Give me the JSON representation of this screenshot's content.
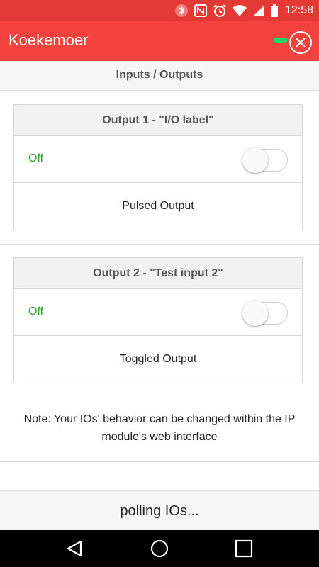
{
  "status_bar": {
    "icons": [
      "bluetooth-icon",
      "nfc-icon",
      "alarm-icon",
      "wifi-icon",
      "cellular-signal-icon",
      "battery-icon"
    ],
    "time": "12:58"
  },
  "app_bar": {
    "title": "Koekemoer",
    "connection_color": "#21d36b",
    "background": "#f4433f"
  },
  "section": {
    "title": "Inputs / Outputs"
  },
  "outputs": [
    {
      "title": "Output 1 - \"I/O label\"",
      "state": "Off",
      "checked": false,
      "mode": "Pulsed Output"
    },
    {
      "title": "Output 2 - \"Test input 2\"",
      "state": "Off",
      "checked": false,
      "mode": "Toggled Output"
    }
  ],
  "note": "Note: Your IOs' behavior can be changed within the IP module's web interface",
  "polling_status": "polling IOs...",
  "nav_bar": {
    "buttons": [
      "back-icon",
      "home-icon",
      "recents-icon"
    ]
  }
}
